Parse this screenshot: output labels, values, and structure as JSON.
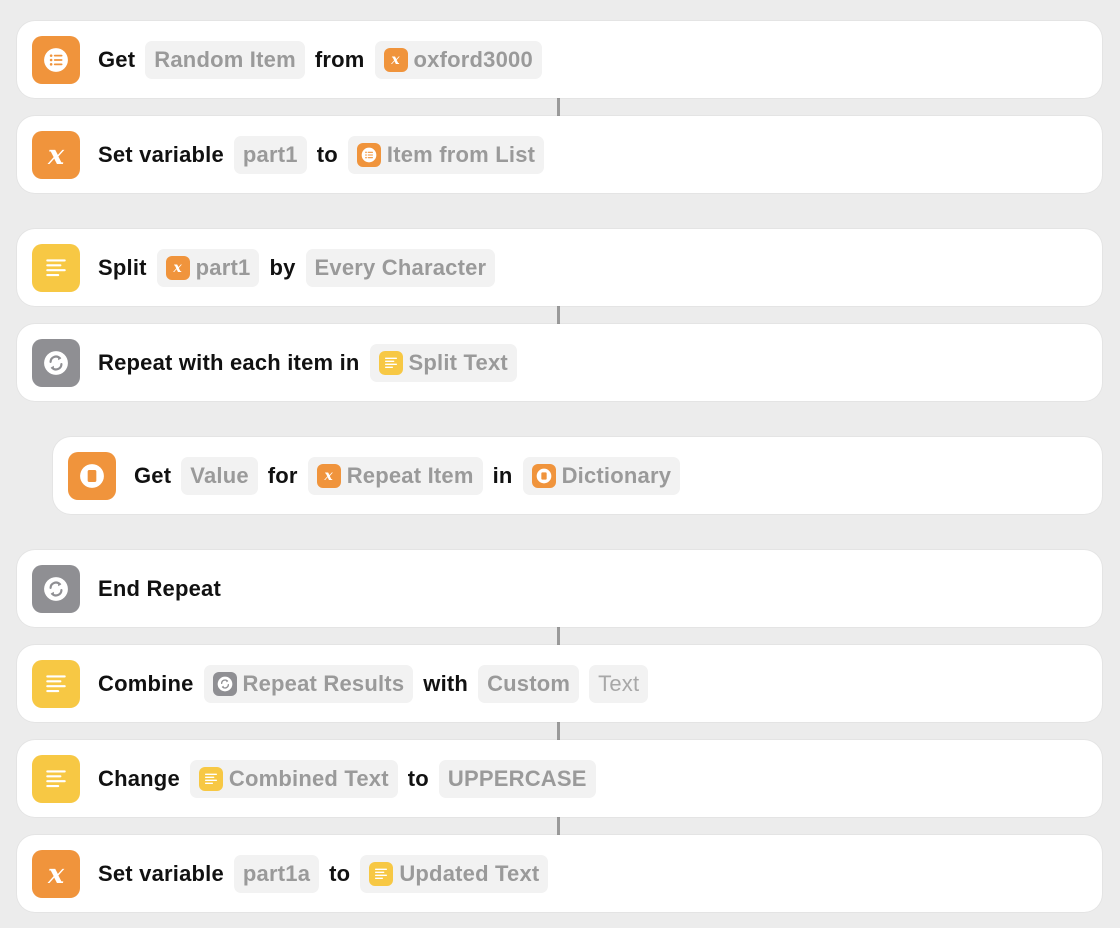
{
  "actions": [
    {
      "icon": "list-icon",
      "color": "orange",
      "parts": [
        {
          "t": "kw",
          "v": "Get"
        },
        {
          "t": "tok",
          "v": "Random Item"
        },
        {
          "t": "kw",
          "v": "from"
        },
        {
          "t": "tok",
          "icon": "variable-icon",
          "ic": "orange",
          "v": "oxford3000"
        }
      ]
    },
    {
      "icon": "variable-icon",
      "color": "orange",
      "parts": [
        {
          "t": "kw",
          "v": "Set variable"
        },
        {
          "t": "tok",
          "v": "part1"
        },
        {
          "t": "kw",
          "v": "to"
        },
        {
          "t": "tok",
          "icon": "list-icon",
          "ic": "orange",
          "v": "Item from List"
        }
      ]
    },
    {
      "icon": "text-icon",
      "color": "yellow",
      "parts": [
        {
          "t": "kw",
          "v": "Split"
        },
        {
          "t": "tok",
          "icon": "variable-icon",
          "ic": "orange",
          "v": "part1"
        },
        {
          "t": "kw",
          "v": "by"
        },
        {
          "t": "tok",
          "v": "Every Character"
        }
      ]
    },
    {
      "icon": "repeat-icon",
      "color": "gray",
      "parts": [
        {
          "t": "kw",
          "v": "Repeat with each item in"
        },
        {
          "t": "tok",
          "icon": "text-icon",
          "ic": "yellow",
          "v": "Split Text"
        }
      ]
    },
    {
      "icon": "dictionary-icon",
      "color": "orange",
      "parts": [
        {
          "t": "kw",
          "v": "Get"
        },
        {
          "t": "tok",
          "v": "Value"
        },
        {
          "t": "kw",
          "v": "for"
        },
        {
          "t": "tok",
          "icon": "variable-icon",
          "ic": "orange",
          "v": "Repeat Item"
        },
        {
          "t": "kw",
          "v": "in"
        },
        {
          "t": "tok",
          "icon": "dictionary-icon",
          "ic": "orange",
          "v": "Dictionary"
        }
      ]
    },
    {
      "icon": "repeat-icon",
      "color": "gray",
      "parts": [
        {
          "t": "kw",
          "v": "End Repeat"
        }
      ]
    },
    {
      "icon": "text-icon",
      "color": "yellow",
      "parts": [
        {
          "t": "kw",
          "v": "Combine"
        },
        {
          "t": "tok",
          "icon": "repeat-icon",
          "ic": "gray",
          "v": "Repeat Results"
        },
        {
          "t": "kw",
          "v": "with"
        },
        {
          "t": "tok",
          "v": "Custom"
        },
        {
          "t": "tok",
          "plain": true,
          "v": "Text"
        }
      ]
    },
    {
      "icon": "text-icon",
      "color": "yellow",
      "parts": [
        {
          "t": "kw",
          "v": "Change"
        },
        {
          "t": "tok",
          "icon": "text-icon",
          "ic": "yellow",
          "v": "Combined Text"
        },
        {
          "t": "kw",
          "v": "to"
        },
        {
          "t": "tok",
          "v": "UPPERCASE"
        }
      ]
    },
    {
      "icon": "variable-icon",
      "color": "orange",
      "parts": [
        {
          "t": "kw",
          "v": "Set variable"
        },
        {
          "t": "tok",
          "v": "part1a"
        },
        {
          "t": "kw",
          "v": "to"
        },
        {
          "t": "tok",
          "icon": "text-icon",
          "ic": "yellow",
          "v": "Updated Text"
        }
      ]
    }
  ]
}
